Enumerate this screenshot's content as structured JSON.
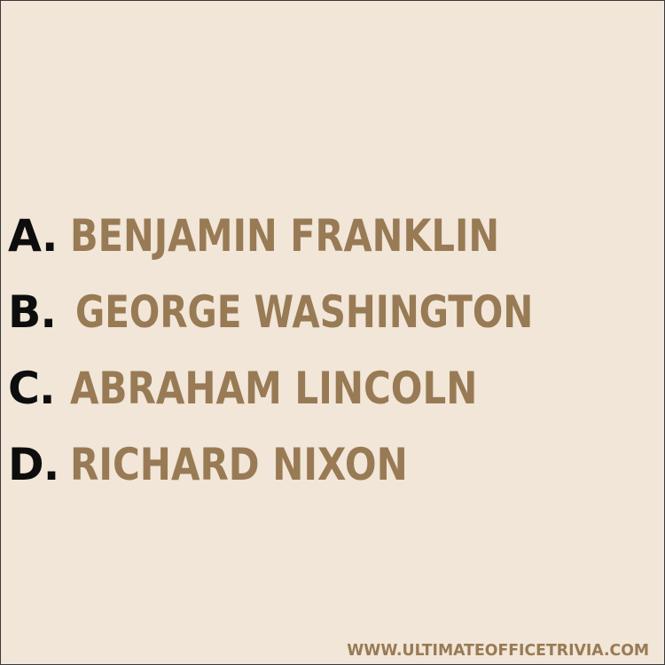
{
  "colors": {
    "background": "#f1e6d7",
    "letter": "#0d0d0d",
    "answer": "#987a55",
    "border": "#3a3a3a"
  },
  "options": [
    {
      "letter": "A.",
      "text": "BENJAMIN FRANKLIN"
    },
    {
      "letter": "B.",
      "text": "GEORGE WASHINGTON"
    },
    {
      "letter": "C.",
      "text": "ABRAHAM LINCOLN"
    },
    {
      "letter": "D.",
      "text": "RICHARD NIXON"
    }
  ],
  "footer": {
    "url": "WWW.ULTIMATEOFFICETRIVIA.COM"
  }
}
